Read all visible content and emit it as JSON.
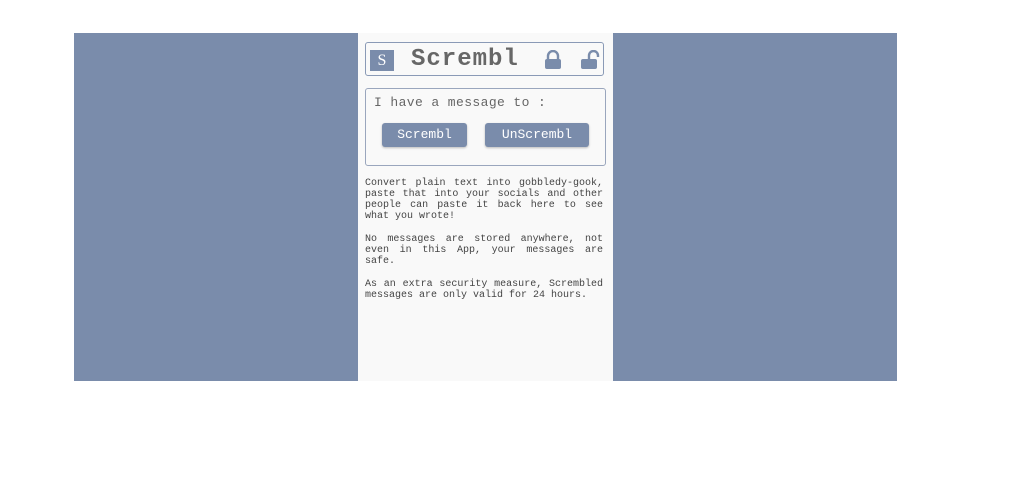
{
  "app": {
    "logo_letter": "S",
    "title": "Scrembl"
  },
  "icons": {
    "lock": "lock-icon",
    "unlock": "unlock-icon"
  },
  "prompt": {
    "text": "I have a message to :"
  },
  "buttons": {
    "scrembl": "Scrembl",
    "unscrembl": "UnScrembl"
  },
  "info": {
    "p1": "Convert plain text into gobbledy-gook, paste that into your socials and other people can paste it back here to see what you wrote!",
    "p2": "No messages are stored anywhere, not even in this App, your messages are safe.",
    "p3": "As an extra security measure, Scrembled messages are only valid for 24 hours."
  },
  "colors": {
    "brand": "#7a8cab",
    "panel": "#f9f9f9",
    "title_text": "#676767"
  }
}
